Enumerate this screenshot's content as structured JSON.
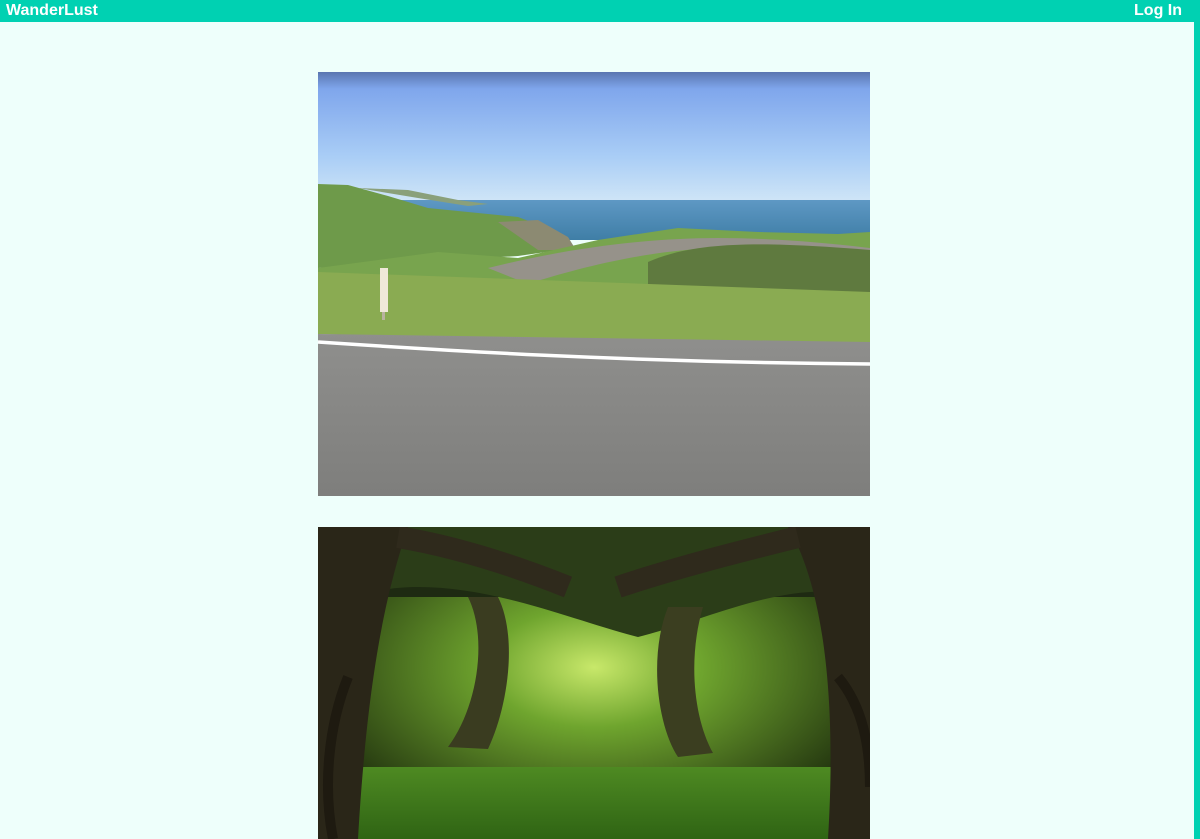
{
  "navbar": {
    "brand": "WanderLust",
    "login_label": "Log In",
    "color": "#00d1b2"
  },
  "page": {
    "background": "#eefffb"
  },
  "gallery": [
    {
      "name": "coastal-road-photo"
    },
    {
      "name": "forest-arch-photo"
    }
  ]
}
